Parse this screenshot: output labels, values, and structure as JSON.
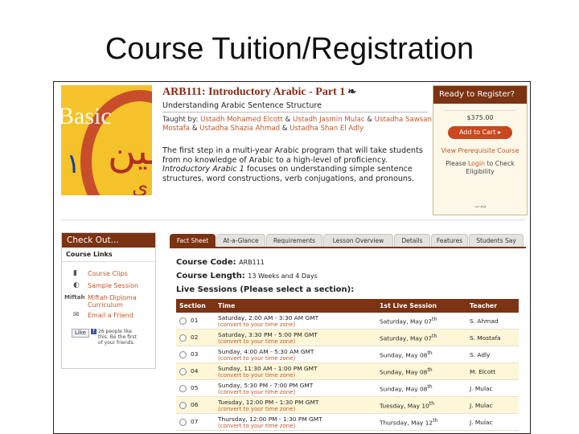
{
  "slide_title": "Course Tuition/Registration",
  "cover": {
    "word": "Basic",
    "numeral": "١",
    "arabic1": "عين",
    "arabic2": "ي"
  },
  "course": {
    "title": "ARB111: Introductory Arabic - Part 1",
    "title_glyph": "❧",
    "subtitle": "Understanding Arabic Sentence Structure",
    "taught_by_label": "Taught by:",
    "instructors": [
      "Ustadh Mohamed Elcott",
      "Ustadh Jasmin Mulac",
      "Ustadha Sawsan Mostafa",
      "Ustadha Shazia Ahmad",
      "Ustadha Shan El Adly"
    ],
    "amp": "&",
    "desc_1": "The first step in a multi-year Arabic program that will take students from no knowledge of Arabic to a high-level of proficiency. ",
    "desc_em": "Introductory Arabic 1",
    "desc_2": " focuses on understanding simple sentence structures, word constructions, verb conjugations, and pronouns."
  },
  "register": {
    "heading": "Ready to Register?",
    "price": "$375.00",
    "add_to_cart": "Add to Cart ▸",
    "view_prereq": "View Prerequisite Course",
    "login_pre": "Please ",
    "login_link": "Login",
    "login_post": " to Check Eligibility",
    "ornament": "∽∾"
  },
  "checkout": {
    "heading": "Check Out...",
    "links_heading": "Course Links",
    "items": [
      {
        "icon": "▮",
        "label": "Course Clips"
      },
      {
        "icon": "◐",
        "label": "Sample Session"
      },
      {
        "icon": "Miftah",
        "label": "Miftah Diploma Curriculum"
      },
      {
        "icon": "✉",
        "label": "Email a Friend"
      }
    ],
    "like": {
      "button": "Like",
      "fb": "f",
      "text": "26 people like this. Be the first of your friends."
    }
  },
  "tabs": [
    "Fact Sheet",
    "At-a-Glance",
    "Requirements",
    "Lesson Overview",
    "Details",
    "Features",
    "Students Say"
  ],
  "facts": {
    "code_label": "Course Code:",
    "code": "ARB111",
    "length_label": "Course Length:",
    "length": "13 Weeks and 4 Days",
    "live_label": "Live Sessions (Please select a section):"
  },
  "sessions": {
    "columns": [
      "Section",
      "Time",
      "1st Live Session",
      "Teacher"
    ],
    "convert": "(convert to your time zone)",
    "rows": [
      {
        "section": "01",
        "time": "Saturday, 2:00 AM - 3:30 AM GMT",
        "first": "Saturday, May 07",
        "sup": "th",
        "teacher": "S. Ahmad"
      },
      {
        "section": "02",
        "time": "Saturday, 3:30 PM - 5:00 PM GMT",
        "first": "Saturday, May 07",
        "sup": "th",
        "teacher": "S. Mostafa"
      },
      {
        "section": "03",
        "time": "Sunday, 4:00 AM - 5:30 AM GMT",
        "first": "Sunday, May 08",
        "sup": "th",
        "teacher": "S. Adly"
      },
      {
        "section": "04",
        "time": "Sunday, 11:30 AM - 1:00 PM GMT",
        "first": "Sunday, May 08",
        "sup": "th",
        "teacher": "M. Elcott"
      },
      {
        "section": "05",
        "time": "Sunday, 5:30 PM - 7:00 PM GMT",
        "first": "Sunday, May 08",
        "sup": "th",
        "teacher": "J. Mulac"
      },
      {
        "section": "06",
        "time": "Tuesday, 12:00 PM - 1:30 PM GMT",
        "first": "Tuesday, May 10",
        "sup": "th",
        "teacher": "J. Mulac"
      },
      {
        "section": "07",
        "time": "Thursday, 12:00 PM - 1:30 PM GMT",
        "first": "Thursday, May 12",
        "sup": "th",
        "teacher": "J. Mulac"
      }
    ]
  }
}
